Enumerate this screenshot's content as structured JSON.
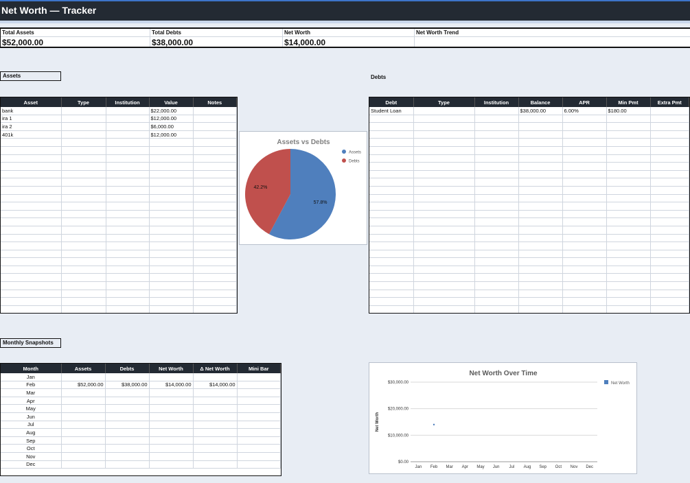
{
  "app": {
    "title": "Net Worth — Tracker"
  },
  "summary": [
    {
      "label": "Total Assets",
      "value": "$52,000.00"
    },
    {
      "label": "Total Debts",
      "value": "$38,000.00"
    },
    {
      "label": "Net Worth",
      "value": "$14,000.00"
    },
    {
      "label": "Net Worth Trend",
      "value": ""
    }
  ],
  "sections": {
    "assets": "Assets",
    "debts": "Debts",
    "snapshots": "Monthly Snapshots"
  },
  "assets_table": {
    "columns": [
      "Asset",
      "Type",
      "Institution",
      "Value",
      "Notes"
    ],
    "rows": [
      [
        "bank",
        "",
        "",
        "$22,000.00",
        ""
      ],
      [
        "ira 1",
        "",
        "",
        "$12,000.00",
        ""
      ],
      [
        "ira 2",
        "",
        "",
        "$6,000.00",
        ""
      ],
      [
        "401k",
        "",
        "",
        "$12,000.00",
        ""
      ]
    ]
  },
  "debts_table": {
    "columns": [
      "Debt",
      "Type",
      "Institution",
      "Balance",
      "APR",
      "Min Pmt",
      "Extra Pmt"
    ],
    "rows": [
      [
        "Student Loan",
        "",
        "",
        "$38,000.00",
        "6.00%",
        "$180.00",
        ""
      ]
    ]
  },
  "snapshots_table": {
    "columns": [
      "Month",
      "Assets",
      "Debts",
      "Net Worth",
      "Δ Net Worth",
      "Mini Bar"
    ],
    "rows": [
      [
        "Jan",
        "",
        "",
        "",
        "",
        ""
      ],
      [
        "Feb",
        "$52,000.00",
        "$38,000.00",
        "$14,000.00",
        "$14,000.00",
        ""
      ],
      [
        "Mar",
        "",
        "",
        "",
        "",
        ""
      ],
      [
        "Apr",
        "",
        "",
        "",
        "",
        ""
      ],
      [
        "May",
        "",
        "",
        "",
        "",
        ""
      ],
      [
        "Jun",
        "",
        "",
        "",
        "",
        ""
      ],
      [
        "Jul",
        "",
        "",
        "",
        "",
        ""
      ],
      [
        "Aug",
        "",
        "",
        "",
        "",
        ""
      ],
      [
        "Sep",
        "",
        "",
        "",
        "",
        ""
      ],
      [
        "Oct",
        "",
        "",
        "",
        "",
        ""
      ],
      [
        "Nov",
        "",
        "",
        "",
        "",
        ""
      ],
      [
        "Dec",
        "",
        "",
        "",
        "",
        ""
      ]
    ]
  },
  "chart_data": [
    {
      "type": "pie",
      "title": "Assets vs Debts",
      "categories": [
        "Assets",
        "Debts"
      ],
      "values": [
        57.8,
        42.2
      ],
      "data_labels": [
        "57.8%",
        "42.2%"
      ],
      "colors": [
        "#4f7fbd",
        "#c0504d"
      ],
      "legend": "right"
    },
    {
      "type": "line",
      "title": "Net Worth Over Time",
      "x": [
        "Jan",
        "Feb",
        "Mar",
        "Apr",
        "May",
        "Jun",
        "Jul",
        "Aug",
        "Sep",
        "Oct",
        "Nov",
        "Dec"
      ],
      "series": [
        {
          "name": "Net Worth",
          "values": [
            null,
            14000,
            null,
            null,
            null,
            null,
            null,
            null,
            null,
            null,
            null,
            null
          ]
        }
      ],
      "ylabel": "Net Worth",
      "xlabel": "",
      "ylim": [
        0,
        30000
      ],
      "yticks": [
        "$0.00",
        "$10,000.00",
        "$20,000.00",
        "$30,000.00"
      ],
      "grid": true,
      "legend": "right",
      "color": "#4f7fbd"
    }
  ]
}
